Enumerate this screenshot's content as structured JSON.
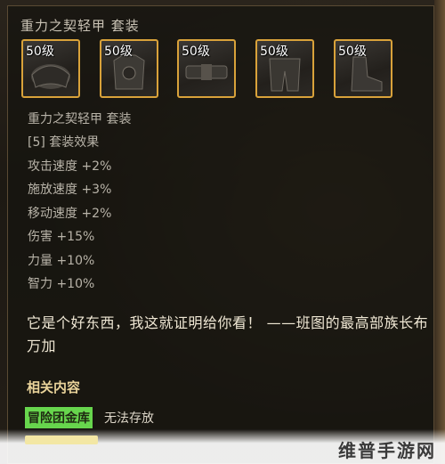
{
  "set_title": "重力之契轻甲 套装",
  "slots": [
    {
      "level": "50级",
      "icon": "shoulder-armor-icon"
    },
    {
      "level": "50级",
      "icon": "chest-armor-icon"
    },
    {
      "level": "50级",
      "icon": "belt-armor-icon"
    },
    {
      "level": "50级",
      "icon": "leg-armor-icon"
    },
    {
      "level": "50级",
      "icon": "boots-armor-icon"
    }
  ],
  "set_bonus": {
    "name": "重力之契轻甲 套装",
    "count_label": "[5] 套装效果",
    "stats": [
      "攻击速度 +2%",
      "施放速度 +3%",
      "移动速度 +2%",
      "伤害 +15%",
      "力量 +10%",
      "智力 +10%"
    ]
  },
  "quote": "它是个好东西，我这就证明给你看！ ——班图的最高部族长布万加",
  "related": {
    "title": "相关内容",
    "badge": "冒险团金库",
    "storage_note": "无法存放"
  },
  "watermark": "维普手游网",
  "colors": {
    "slot_border": "#d9a23a",
    "badge_green": "#67d64d",
    "related_title": "#e9d39a"
  }
}
